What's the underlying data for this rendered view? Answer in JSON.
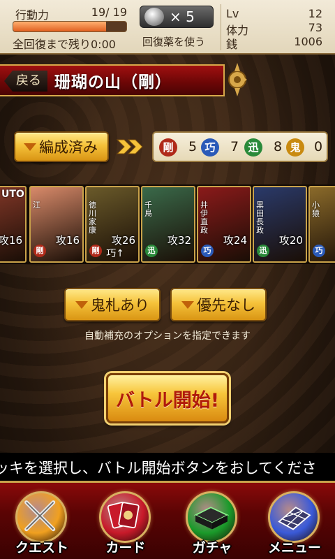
{
  "status": {
    "stamina_label": "行動力",
    "stamina_value": "19/ 19",
    "stamina_fraction": 0.82,
    "recovery_text": "全回復まで残り0:00",
    "potion_count": "× 5",
    "use_potion_label": "回復薬を使う",
    "level_label": "Lv",
    "level_value": "12",
    "hp_label": "体力",
    "hp_value": "73",
    "money_label": "銭",
    "money_value": "1006"
  },
  "header": {
    "back_label": "戻る",
    "title": "珊瑚の山（剛）"
  },
  "formation": {
    "button_label": "編成済み",
    "attributes": [
      {
        "icon": "剛",
        "count": "5",
        "color": "#b02a1a"
      },
      {
        "icon": "巧",
        "count": "7",
        "color": "#2a5ab8"
      },
      {
        "icon": "迅",
        "count": "8",
        "color": "#2a8a3a"
      },
      {
        "icon": "鬼",
        "count": "0",
        "color": "#c98a10"
      }
    ]
  },
  "cards": [
    {
      "name": "UTO",
      "attack": "攻16",
      "attr": "",
      "attr_color": "#b02a1a",
      "sub": "",
      "bg": "#8a3a2a"
    },
    {
      "name": "江",
      "attack": "攻16",
      "attr": "剛",
      "attr_color": "#b02a1a",
      "sub": "",
      "bg": "#d88a6a"
    },
    {
      "name": "徳川家康",
      "attack": "攻26",
      "attr": "剛",
      "attr_color": "#b02a1a",
      "sub": "巧↑",
      "bg": "#6a5a2a"
    },
    {
      "name": "千鳥",
      "attack": "攻32",
      "attr": "迅",
      "attr_color": "#2a8a3a",
      "sub": "",
      "bg": "#3a6a4a"
    },
    {
      "name": "井伊直政",
      "attack": "攻24",
      "attr": "巧",
      "attr_color": "#2a5ab8",
      "sub": "",
      "bg": "#8a1a1a"
    },
    {
      "name": "黒田長政",
      "attack": "攻20",
      "attr": "迅",
      "attr_color": "#2a8a3a",
      "sub": "",
      "bg": "#2a3a6a"
    },
    {
      "name": "小猿",
      "attack": "",
      "attr": "巧",
      "attr_color": "#2a5ab8",
      "sub": "",
      "bg": "#8a6a2a"
    }
  ],
  "options": {
    "oni_label": "鬼札あり",
    "priority_label": "優先なし",
    "hint": "自動補充のオプションを指定できます"
  },
  "battle": {
    "start_label": "バトル開始!"
  },
  "marquee": {
    "text": "ッキを選択し、バトル開始ボタンをおしてくださ"
  },
  "nav": [
    {
      "label": "クエスト",
      "icon": "crossed-swords-icon",
      "color": "#f0a020"
    },
    {
      "label": "カード",
      "icon": "cards-icon",
      "color": "#c81a2a"
    },
    {
      "label": "ガチャ",
      "icon": "gacha-box-icon",
      "color": "#1a9a2a"
    },
    {
      "label": "メニュー",
      "icon": "grid-menu-icon",
      "color": "#3a5ad8"
    }
  ]
}
